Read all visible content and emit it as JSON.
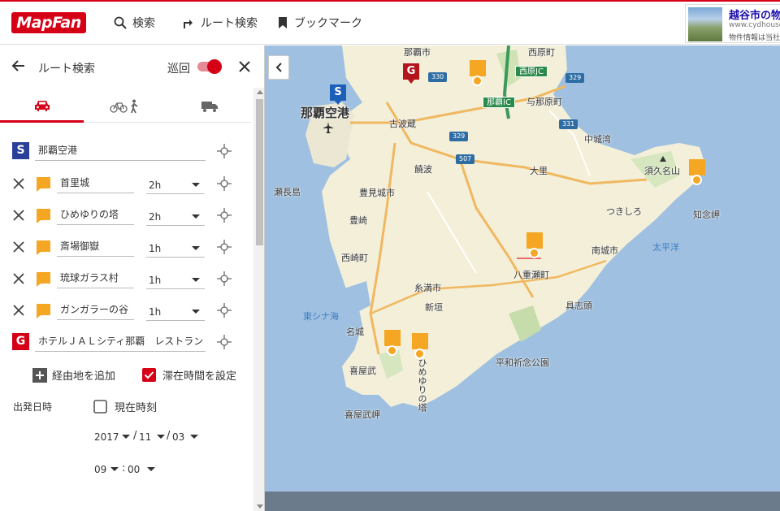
{
  "header": {
    "logo": "MapFan",
    "nav": [
      {
        "label": "検索",
        "icon": "search-icon"
      },
      {
        "label": "ルート検索",
        "icon": "route-icon"
      },
      {
        "label": "ブックマーク",
        "icon": "bookmark-icon"
      }
    ],
    "ad": {
      "title": "越谷市の物",
      "url": "www.cydhouse",
      "desc": "物件情報は当社へ"
    }
  },
  "panel": {
    "title": "ルート検索",
    "loop_label": "巡回",
    "loop_enabled": true,
    "tabs": [
      {
        "name": "car",
        "icon": "car-icon",
        "active": true
      },
      {
        "name": "bicycle-walk",
        "icon": "bicycle-walk-icon",
        "active": false
      },
      {
        "name": "truck",
        "icon": "truck-icon",
        "active": false
      }
    ],
    "start": {
      "marker": "S",
      "value": "那覇空港"
    },
    "waypoints": [
      {
        "name": "首里城",
        "duration": "2h"
      },
      {
        "name": "ひめゆりの塔",
        "duration": "2h"
      },
      {
        "name": "斎場御嶽",
        "duration": "1h"
      },
      {
        "name": "琉球ガラス村",
        "duration": "1h"
      },
      {
        "name": "ガンガラーの谷",
        "duration": "1h"
      }
    ],
    "goal": {
      "marker": "G",
      "value": "ホテルＪＡＬシティ那覇　レストラン"
    },
    "add_via_label": "経由地を追加",
    "stay_label": "滞在時間を設定",
    "stay_checked": true,
    "depart_label": "出発日時",
    "now_label": "現在時刻",
    "now_checked": false,
    "date": {
      "year": "2017",
      "month": "11",
      "day": "03",
      "hour": "09",
      "minute": "00"
    }
  },
  "map": {
    "labels": {
      "airport": "那覇空港",
      "furuhagura": "古波蔵",
      "tobaru": "饒波",
      "tomigusuku": "豊見城市",
      "toyosaki": "豊崎",
      "nishizaki": "西崎町",
      "itoman": "糸満市",
      "shinkaki": "新垣",
      "higashi": "東シナ海",
      "nagusuku": "名城",
      "kiyan": "喜屋武",
      "kiyanmisaki": "喜屋武岬",
      "himeyuri": "ひめゆりの塔",
      "heiwa": "平和祈念公園",
      "ozato": "大里",
      "yaese": "八重瀬町",
      "gushiken": "具志頭",
      "nanjo": "南城市",
      "tsukishiro": "つきしろ",
      "chinen": "知念岬",
      "sukuna": "須久名山",
      "nakagusuku": "中城湾",
      "taiheiyo": "太平洋",
      "senaga": "瀬長島",
      "nishihara": "西原町",
      "yonabaru": "与那原町",
      "nishihara_jc": "西原JC",
      "naha_ic": "那覇IC",
      "naha_city": "那覇市",
      "route_330": "330",
      "route_329": "329",
      "route_331": "331",
      "route_507": "507",
      "route_329b": "329"
    }
  }
}
